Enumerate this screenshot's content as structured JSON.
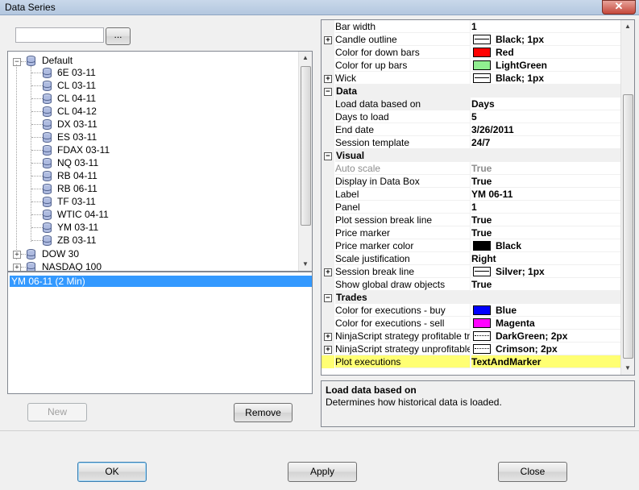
{
  "window": {
    "title": "Data Series",
    "close_glyph": "✕"
  },
  "search": {
    "value": "",
    "browse_label": "..."
  },
  "tree": {
    "root": {
      "label": "Default",
      "expanded": true
    },
    "children": [
      "6E 03-11",
      "CL 03-11",
      "CL 04-11",
      "CL 04-12",
      "DX 03-11",
      "ES 03-11",
      "FDAX 03-11",
      "NQ 03-11",
      "RB 04-11",
      "RB 06-11",
      "TF 03-11",
      "WTIC 04-11",
      "YM 03-11",
      "ZB 03-11"
    ],
    "collapsed": [
      "DOW 30",
      "NASDAQ 100"
    ]
  },
  "series_list": {
    "items": [
      "YM 06-11 (2 Min)"
    ],
    "selected_index": 0
  },
  "buttons": {
    "new": "New",
    "remove": "Remove",
    "ok": "OK",
    "apply": "Apply",
    "close": "Close"
  },
  "grid": {
    "rows": [
      {
        "type": "prop",
        "name": "Bar width",
        "value": "1"
      },
      {
        "type": "prop",
        "name": "Candle outline",
        "value": "Black; 1px",
        "swatch": "line",
        "expand": true
      },
      {
        "type": "prop",
        "name": "Color for down bars",
        "value": "Red",
        "swatch_color": "#ff0000"
      },
      {
        "type": "prop",
        "name": "Color for up bars",
        "value": "LightGreen",
        "swatch_color": "#90ee90"
      },
      {
        "type": "prop",
        "name": "Wick",
        "value": "Black; 1px",
        "swatch": "line",
        "expand": true
      },
      {
        "type": "cat",
        "name": "Data"
      },
      {
        "type": "prop",
        "name": "Load data based on",
        "value": "Days",
        "selected": true
      },
      {
        "type": "prop",
        "name": "Days to load",
        "value": "5"
      },
      {
        "type": "prop",
        "name": "End date",
        "value": "3/26/2011"
      },
      {
        "type": "prop",
        "name": "Session template",
        "value": "24/7"
      },
      {
        "type": "cat",
        "name": "Visual"
      },
      {
        "type": "prop",
        "name": "Auto scale",
        "value": "True",
        "disabled": true
      },
      {
        "type": "prop",
        "name": "Display in Data Box",
        "value": "True"
      },
      {
        "type": "prop",
        "name": "Label",
        "value": "YM 06-11"
      },
      {
        "type": "prop",
        "name": "Panel",
        "value": "1"
      },
      {
        "type": "prop",
        "name": "Plot session break line",
        "value": "True"
      },
      {
        "type": "prop",
        "name": "Price marker",
        "value": "True"
      },
      {
        "type": "prop",
        "name": "Price marker color",
        "value": "Black",
        "swatch_color": "#000000"
      },
      {
        "type": "prop",
        "name": "Scale justification",
        "value": "Right"
      },
      {
        "type": "prop",
        "name": "Session break line",
        "value": "Silver; 1px",
        "swatch": "line",
        "expand": true
      },
      {
        "type": "prop",
        "name": "Show global draw objects",
        "value": "True"
      },
      {
        "type": "cat",
        "name": "Trades"
      },
      {
        "type": "prop",
        "name": "Color for executions - buy",
        "value": "Blue",
        "swatch_color": "#0000ff"
      },
      {
        "type": "prop",
        "name": "Color for executions - sell",
        "value": "Magenta",
        "swatch_color": "#ff00ff"
      },
      {
        "type": "prop",
        "name": "NinjaScript strategy profitable trad",
        "value": "DarkGreen; 2px",
        "swatch": "dotted",
        "expand": true
      },
      {
        "type": "prop",
        "name": "NinjaScript strategy unprofitable tr",
        "value": "Crimson; 2px",
        "swatch": "dotted",
        "expand": true
      },
      {
        "type": "prop",
        "name": "Plot executions",
        "value": "TextAndMarker"
      }
    ]
  },
  "description": {
    "title": "Load data based on",
    "text": "Determines how historical data is loaded."
  },
  "colors": {
    "selection": "#3399ff",
    "highlight": "#ffff00"
  }
}
